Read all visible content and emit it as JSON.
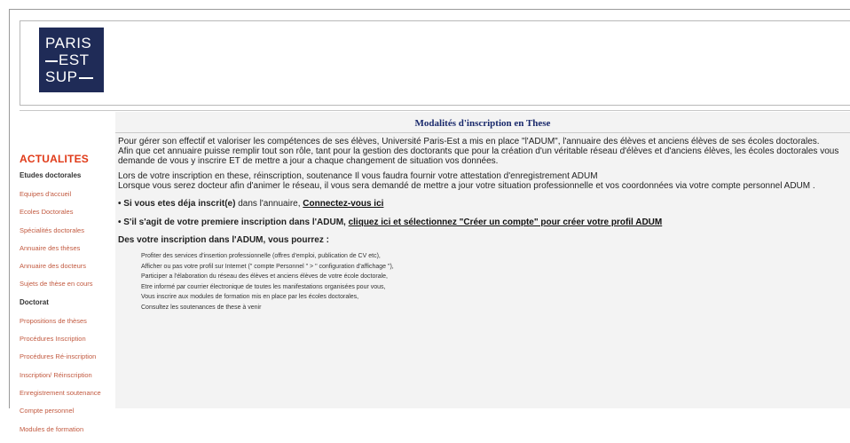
{
  "logo": {
    "line1": "PARIS",
    "line2": "EST",
    "line3": "SUP"
  },
  "content": {
    "title": "Modalités d'inscription en These",
    "para1": [
      "Pour gérer son effectif et valoriser les compétences de ses élèves, Université Paris-Est a mis en place \"l'ADUM\", l'annuaire des élèves et anciens élèves de ses écoles doctorales.",
      "Afin que cet annuaire puisse remplir tout son rôle, tant pour la gestion des doctorants que pour la création d'un véritable réseau d'élèves et d'anciens élèves, les écoles doctorales vous",
      "demande de vous y inscrire ET de mettre a jour a chaque changement de situation vos données."
    ],
    "para2": [
      "Lors de votre inscription en these, réinscription, soutenance Il vous faudra fournir votre attestation d'enregistrement ADUM",
      "Lorsque vous serez docteur afin d'animer le réseau, il vous sera demandé de mettre a jour votre situation professionnelle et vos coordonnées via votre compte personnel  ADUM ."
    ],
    "already_prefix": "• Si vous etes déja inscrit(e)",
    "already_mid": " dans l'annuaire, ",
    "already_link": "Connectez-vous ici",
    "first_prefix": "• S'il s'agit de votre premiere inscription dans l'ADUM, ",
    "first_link": "cliquez ici et sélectionnez \"Créer un compte\" pour créer votre profil ADUM",
    "benefits_heading": "Des votre inscription dans l'ADUM, vous pourrez :",
    "benefits": [
      "Profiter des services d'insertion professionnelle (offres d'emploi, publication de CV etc),",
      "Afficher ou pas votre profil sur Internet (\" compte Personnel \" > \" configuration d'affichage \"),",
      "Participer a l'élaboration du réseau des élèves et anciens élèves de votre école doctorale,",
      "Etre informé par courrier électronique de toutes les manifestations organisées pour vous,",
      "Vous inscrire aux modules de formation mis en place par les écoles doctorales,",
      "Consultez les soutenances de these à venir"
    ]
  },
  "sidebar": {
    "heading": "ACTUALITES",
    "section1": "Etudes doctorales",
    "items1": [
      "Equipes d'accueil",
      "Ecoles Doctorales",
      "Spécialités doctorales",
      "Annuaire des thèses",
      "Annuaire des docteurs",
      "Sujets de thèse en cours"
    ],
    "section2": "Doctorat",
    "items2": [
      "Propositions de thèses",
      "Procédures Inscription",
      "Procédures Ré-inscription",
      "Inscription/ Réinscription",
      "Enregistrement soutenance",
      "Compte personnel",
      "Modules de formation"
    ]
  },
  "colors": {
    "logo_bg": "#1f2b57",
    "sidebar_heading": "#e03a18",
    "sidebar_link": "#c25a40",
    "title": "#1a2a6c"
  }
}
